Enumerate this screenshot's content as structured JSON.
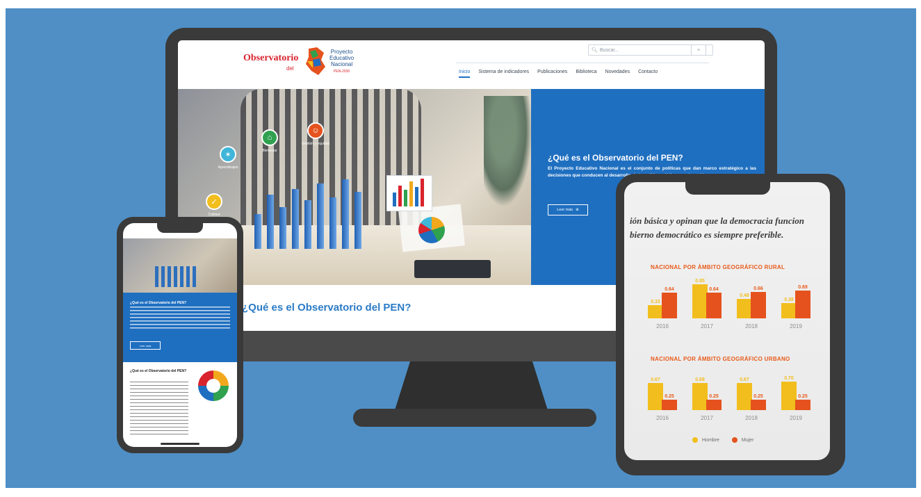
{
  "desktop": {
    "logo": {
      "word": "Observatorio",
      "del": "del",
      "line1": "Proyecto",
      "line2": "Educativo",
      "line3": "Nacional",
      "tag": "PEN-2030"
    },
    "search": {
      "placeholder": "Buscar..."
    },
    "nav": [
      "Inicio",
      "Sistema de indicadores",
      "Publicaciones",
      "Biblioteca",
      "Novedades",
      "Contacto"
    ],
    "hero": {
      "title": "¿Qué es el Observatorio del PEN?",
      "text": "El Proyecto Educativo Nacional es el conjunto de políticas que dan marco estratégico a las decisiones que conducen al desarrollo de la política pública en educación.",
      "button": "Leer más",
      "icons": [
        {
          "label": "Aprendizajes"
        },
        {
          "label": "Bienestar"
        },
        {
          "label": "Gestión y equidad"
        },
        {
          "label": "Calidad"
        }
      ]
    },
    "section_title": "¿Qué es el Observatorio del PEN?"
  },
  "phone": {
    "blue_title": "¿Qué es el Observatorio del PEN?",
    "button": "Leer más",
    "white_title": "¿Qué es el Observatorio del PEN?"
  },
  "tablet": {
    "quote_line1": "ión básica y opinan que la democracia funcion",
    "quote_line2": "bierno democrático es siempre preferible.",
    "legend": {
      "h_label": "Hombre",
      "m_label": "Mujer",
      "h_color": "#f2be1d",
      "m_color": "#e5521d"
    }
  },
  "chart_data": [
    {
      "type": "bar",
      "title": "NACIONAL POR ÁMBITO GEOGRÁFICO RURAL",
      "categories": [
        "2016",
        "2017",
        "2018",
        "2019"
      ],
      "series": [
        {
          "name": "Hombre",
          "values": [
            0.33,
            0.85,
            0.48,
            0.38
          ]
        },
        {
          "name": "Mujer",
          "values": [
            0.64,
            0.64,
            0.66,
            0.69
          ]
        }
      ],
      "ylim": [
        0,
        1
      ]
    },
    {
      "type": "bar",
      "title": "NACIONAL POR ÁMBITO GEOGRÁFICO URBANO",
      "categories": [
        "2016",
        "2017",
        "2018",
        "2019"
      ],
      "series": [
        {
          "name": "Hombre",
          "values": [
            0.67,
            0.68,
            0.67,
            0.7
          ]
        },
        {
          "name": "Mujer",
          "values": [
            0.25,
            0.25,
            0.25,
            0.25
          ]
        }
      ],
      "ylim": [
        0,
        1
      ]
    }
  ]
}
